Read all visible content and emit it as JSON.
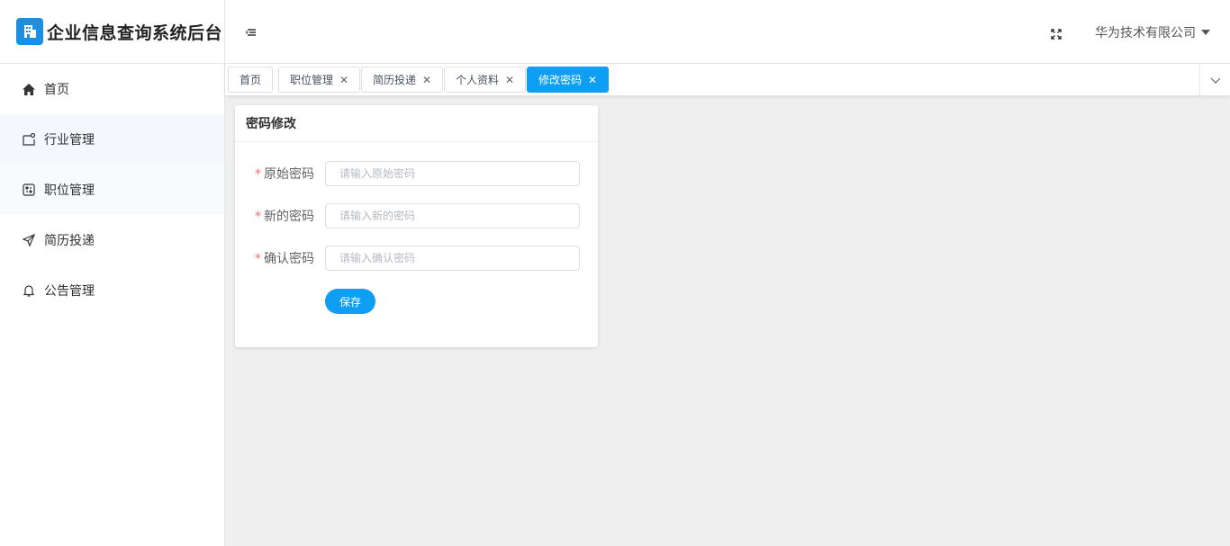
{
  "app": {
    "title": "企业信息查询系统后台"
  },
  "sidebar": {
    "items": [
      {
        "label": "首页",
        "icon": "home-icon"
      },
      {
        "label": "行业管理",
        "icon": "industry-icon"
      },
      {
        "label": "职位管理",
        "icon": "position-icon"
      },
      {
        "label": "简历投递",
        "icon": "send-icon"
      },
      {
        "label": "公告管理",
        "icon": "bell-icon"
      }
    ]
  },
  "header": {
    "user_name": "华为技术有限公司"
  },
  "tabs": [
    {
      "label": "首页",
      "closable": false
    },
    {
      "label": "职位管理",
      "closable": true
    },
    {
      "label": "简历投递",
      "closable": true
    },
    {
      "label": "个人资料",
      "closable": true
    },
    {
      "label": "修改密码",
      "closable": true,
      "active": true
    }
  ],
  "close_glyph": "✕",
  "card": {
    "title": "密码修改",
    "fields": [
      {
        "required_mark": "*",
        "label": "原始密码",
        "placeholder": "请输入原始密码",
        "value": ""
      },
      {
        "required_mark": "*",
        "label": "新的密码",
        "placeholder": "请输入新的密码",
        "value": ""
      },
      {
        "required_mark": "*",
        "label": "确认密码",
        "placeholder": "请输入确认密码",
        "value": ""
      }
    ],
    "save_label": "保存"
  },
  "colors": {
    "accent": "#0e9ff5",
    "logo": "#1e8fe0",
    "required": "#f56c6c",
    "background": "#efefef"
  }
}
